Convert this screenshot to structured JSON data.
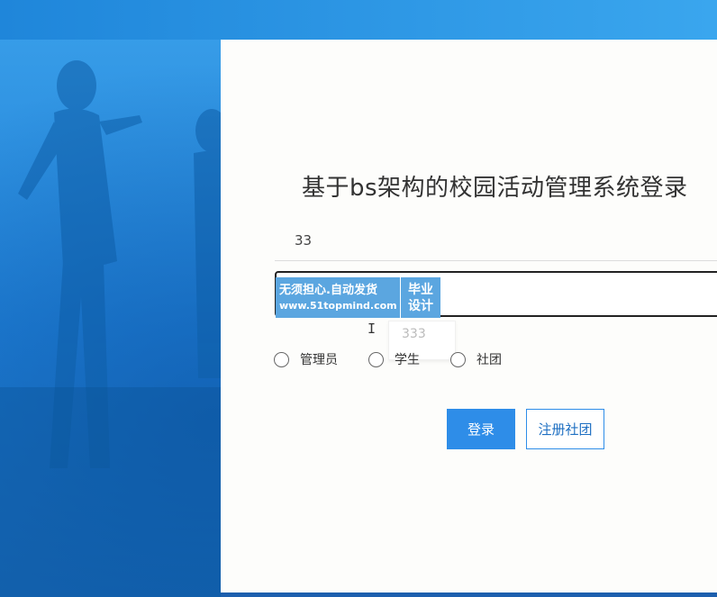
{
  "page": {
    "title": "基于bs架构的校园活动管理系统登录"
  },
  "form": {
    "username_value": "33",
    "password_value": "",
    "suggestion": "333",
    "roles": [
      {
        "label": "管理员"
      },
      {
        "label": "学生"
      },
      {
        "label": "社团"
      }
    ],
    "login_label": "登录",
    "register_label": "注册社团"
  },
  "watermark": {
    "line1": "无须担心.自动发货",
    "line2": "www.51topmind.com",
    "right_top": "毕业",
    "right_bottom": "设计"
  },
  "colors": {
    "brand_blue": "#2e8de8",
    "background_blue": "#2a8fe0",
    "panel": "#fdfdfb"
  },
  "icons": {
    "text_cursor": "text-cursor-icon"
  }
}
